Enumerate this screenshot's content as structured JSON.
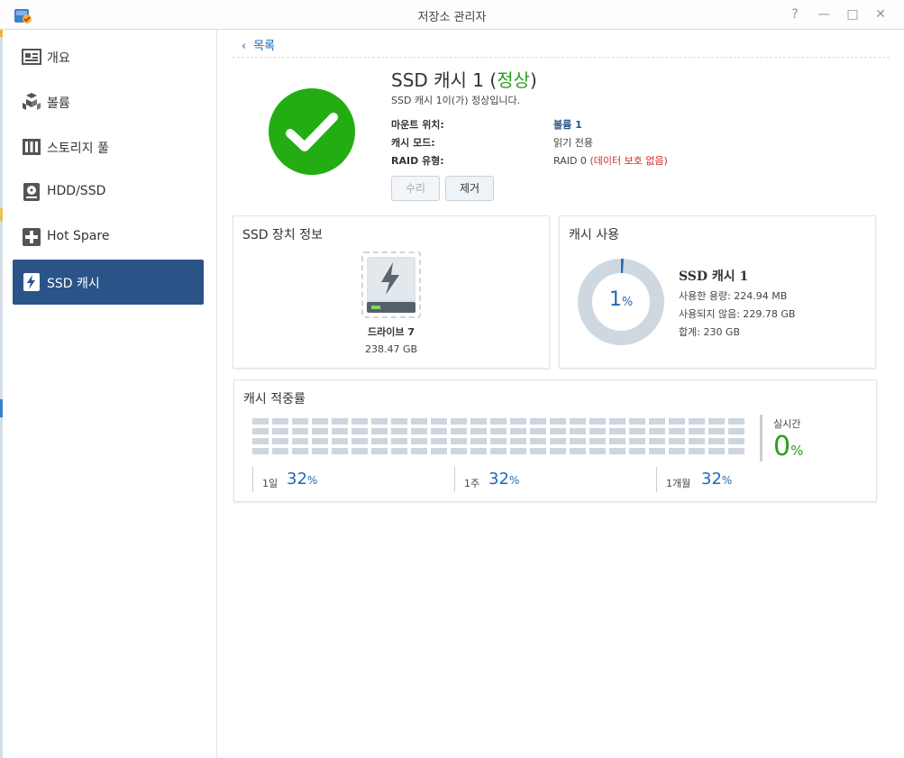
{
  "window": {
    "title": "저장소 관리자",
    "controls": [
      "?",
      "—",
      "□",
      "✕"
    ],
    "app_icon": "storage-manager-icon"
  },
  "sidebar": {
    "items": [
      {
        "label": "개요",
        "icon": "overview-icon",
        "active": false
      },
      {
        "label": "볼륨",
        "icon": "volume-icon",
        "active": false
      },
      {
        "label": "스토리지 풀",
        "icon": "storage-pool-icon",
        "active": false
      },
      {
        "label": "HDD/SSD",
        "icon": "hdd-icon",
        "active": false
      },
      {
        "label": "Hot Spare",
        "icon": "hot-spare-icon",
        "active": false
      },
      {
        "label": "SSD 캐시",
        "icon": "ssd-cache-icon",
        "active": true
      }
    ]
  },
  "main": {
    "back_label": "목록",
    "header": {
      "title_prefix": "SSD 캐시 1 (",
      "status": "정상",
      "title_suffix": ")",
      "subtitle": "SSD 캐시 1이(가) 정상입니다.",
      "fields": [
        {
          "key": "마운트 위치:",
          "value": "볼륨 1"
        },
        {
          "key": "캐시 모드:",
          "value": "읽기 전용"
        },
        {
          "key": "RAID 유형:",
          "value": "RAID 0",
          "note": "(데이터 보호 없음)"
        }
      ],
      "repair_button": "수리",
      "remove_button": "제거"
    },
    "device_info": {
      "title": "SSD 장치 정보",
      "drive_name": "드라이브 7",
      "drive_size": "238.47 GB"
    },
    "cache_usage": {
      "title": "캐시 사용",
      "percent": 1,
      "percent_label": "1",
      "percent_unit": "%",
      "name": "SSD 캐시 1",
      "used": "사용한 용량: 224.94 MB",
      "unused": "사용되지 않음: 229.78 GB",
      "total": "합계: 230 GB"
    },
    "hit_rate": {
      "title": "캐시 적중률",
      "realtime_label": "실시간",
      "realtime_value": "0",
      "realtime_unit": "%",
      "periods": [
        {
          "label": "1일",
          "value": "32",
          "unit": "%"
        },
        {
          "label": "1주",
          "value": "32",
          "unit": "%"
        },
        {
          "label": "1개월",
          "value": "32",
          "unit": "%"
        }
      ]
    }
  },
  "colors": {
    "accent": "#2a5488",
    "link": "#1f6bb3",
    "ok": "#23ad13",
    "warn": "#d22d2d"
  }
}
